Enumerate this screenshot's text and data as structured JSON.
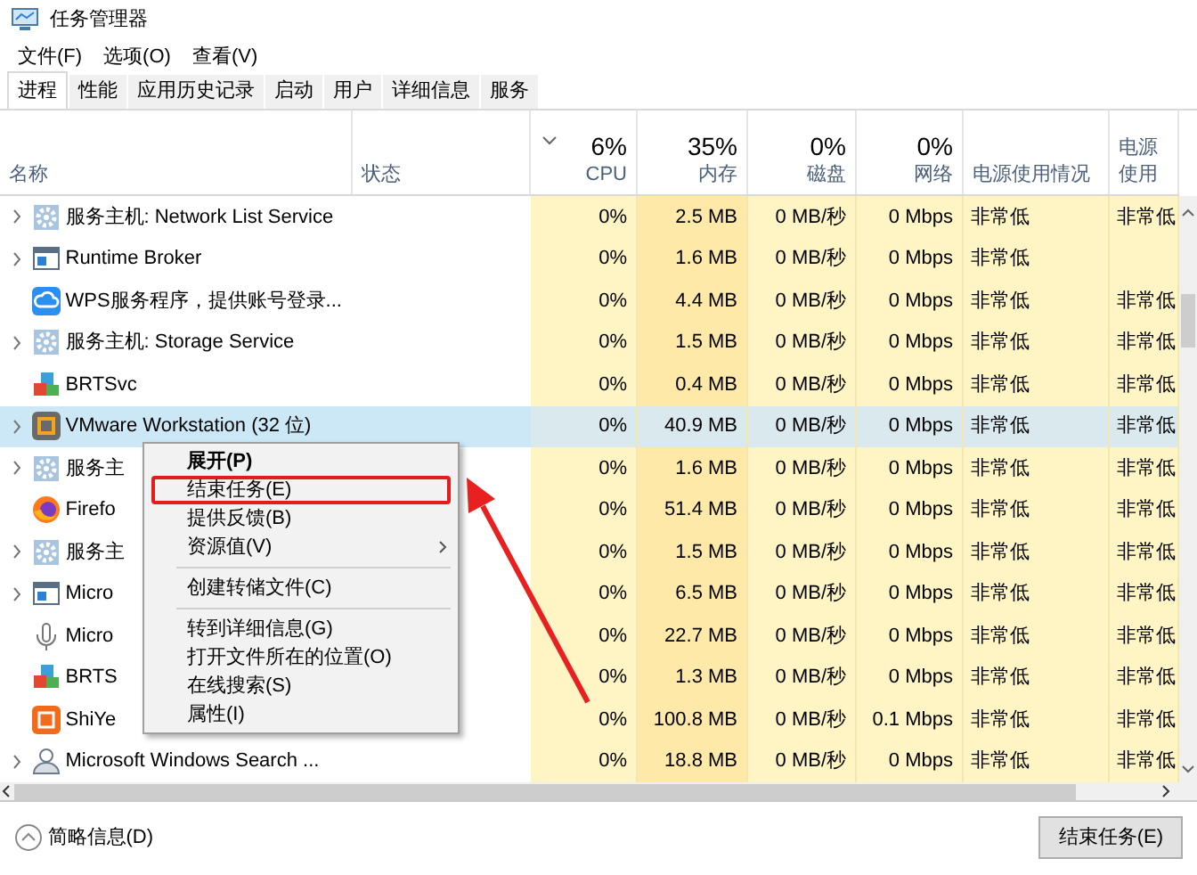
{
  "window": {
    "title": "任务管理器"
  },
  "menu": [
    "文件(F)",
    "选项(O)",
    "查看(V)"
  ],
  "tabs": [
    {
      "label": "进程",
      "selected": true
    },
    {
      "label": "性能",
      "selected": false
    },
    {
      "label": "应用历史记录",
      "selected": false
    },
    {
      "label": "启动",
      "selected": false
    },
    {
      "label": "用户",
      "selected": false
    },
    {
      "label": "详细信息",
      "selected": false
    },
    {
      "label": "服务",
      "selected": false
    }
  ],
  "columns": [
    {
      "label": "名称"
    },
    {
      "label": "状态"
    },
    {
      "usage": "6%",
      "label": "CPU",
      "sorted": true
    },
    {
      "usage": "35%",
      "label": "内存",
      "sorted": false
    },
    {
      "usage": "0%",
      "label": "磁盘",
      "sorted": false
    },
    {
      "usage": "0%",
      "label": "网络",
      "sorted": false
    },
    {
      "label": "电源使用情况"
    },
    {
      "label": "电源使用"
    }
  ],
  "rows": [
    {
      "name": "服务主机: Network List Service",
      "expandable": true,
      "kind": "gear",
      "cpu": "0%",
      "memory": "2.5 MB",
      "disk": "0 MB/秒",
      "network": "0 Mbps",
      "power": "非常低",
      "power_trend": "非常低",
      "selected": false
    },
    {
      "name": "Runtime Broker",
      "expandable": true,
      "kind": "window",
      "cpu": "0%",
      "memory": "1.6 MB",
      "disk": "0 MB/秒",
      "network": "0 Mbps",
      "power": "非常低",
      "selected": false
    },
    {
      "name": "WPS服务程序，提供账号登录...",
      "expandable": false,
      "kind": "cloud",
      "cpu": "0%",
      "memory": "4.4 MB",
      "disk": "0 MB/秒",
      "network": "0 Mbps",
      "power": "非常低",
      "power_trend": "非常低",
      "selected": false
    },
    {
      "name": "服务主机: Storage Service",
      "expandable": true,
      "kind": "gear",
      "cpu": "0%",
      "memory": "1.5 MB",
      "disk": "0 MB/秒",
      "network": "0 Mbps",
      "power": "非常低",
      "power_trend": "非常低",
      "selected": false
    },
    {
      "name": "BRTSvc",
      "expandable": false,
      "kind": "blocks",
      "cpu": "0%",
      "memory": "0.4 MB",
      "disk": "0 MB/秒",
      "network": "0 Mbps",
      "power": "非常低",
      "power_trend": "非常低",
      "selected": false
    },
    {
      "name": "VMware Workstation (32 位)",
      "expandable": true,
      "kind": "vm",
      "cpu": "0%",
      "memory": "40.9 MB",
      "disk": "0 MB/秒",
      "network": "0 Mbps",
      "power": "非常低",
      "power_trend": "非常低",
      "selected": true
    },
    {
      "name": "服务主",
      "expandable": true,
      "kind": "gear",
      "cpu": "0%",
      "memory": "1.6 MB",
      "disk": "0 MB/秒",
      "network": "0 Mbps",
      "power": "非常低",
      "power_trend": "非常低",
      "selected": false
    },
    {
      "name": "Firefo",
      "expandable": false,
      "kind": "fox",
      "cpu": "0%",
      "memory": "51.4 MB",
      "disk": "0 MB/秒",
      "network": "0 Mbps",
      "power": "非常低",
      "power_trend": "非常低",
      "selected": false
    },
    {
      "name": "服务主",
      "expandable": true,
      "kind": "gear",
      "cpu": "0%",
      "memory": "1.5 MB",
      "disk": "0 MB/秒",
      "network": "0 Mbps",
      "power": "非常低",
      "power_trend": "非常低",
      "selected": false
    },
    {
      "name": "Micro",
      "expandable": true,
      "kind": "window",
      "cpu": "0%",
      "memory": "6.5 MB",
      "disk": "0 MB/秒",
      "network": "0 Mbps",
      "power": "非常低",
      "power_trend": "非常低",
      "selected": false
    },
    {
      "name": "Micro",
      "expandable": false,
      "kind": "mic",
      "cpu": "0%",
      "memory": "22.7 MB",
      "disk": "0 MB/秒",
      "network": "0 Mbps",
      "power": "非常低",
      "power_trend": "非常低",
      "selected": false
    },
    {
      "name": "BRTS",
      "expandable": false,
      "kind": "blocks",
      "cpu": "0%",
      "memory": "1.3 MB",
      "disk": "0 MB/秒",
      "network": "0 Mbps",
      "power": "非常低",
      "power_trend": "非常低",
      "selected": false
    },
    {
      "name": "ShiYe",
      "expandable": false,
      "kind": "app",
      "cpu": "0%",
      "memory": "100.8 MB",
      "disk": "0 MB/秒",
      "network": "0.1 Mbps",
      "power": "非常低",
      "power_trend": "非常低",
      "selected": false
    },
    {
      "name": "Microsoft Windows Search ...",
      "expandable": true,
      "kind": "person",
      "cpu": "0%",
      "memory": "18.8 MB",
      "disk": "0 MB/秒",
      "network": "0 Mbps",
      "power": "非常低",
      "power_trend": "非常低",
      "selected": false
    }
  ],
  "context_menu": [
    {
      "kind": "item",
      "label": "展开(P)",
      "bold": true,
      "highlighted": false
    },
    {
      "kind": "item",
      "label": "结束任务(E)",
      "bold": false,
      "highlighted": true
    },
    {
      "kind": "item",
      "label": "提供反馈(B)",
      "bold": false,
      "highlighted": false
    },
    {
      "kind": "submenu",
      "label": "资源值(V)",
      "bold": false,
      "highlighted": false
    },
    {
      "kind": "separator"
    },
    {
      "kind": "item",
      "label": "创建转储文件(C)",
      "bold": false,
      "highlighted": false
    },
    {
      "kind": "separator"
    },
    {
      "kind": "item",
      "label": "转到详细信息(G)",
      "bold": false,
      "highlighted": false
    },
    {
      "kind": "item",
      "label": "打开文件所在的位置(O)",
      "bold": false,
      "highlighted": false
    },
    {
      "kind": "item",
      "label": "在线搜索(S)",
      "bold": false,
      "highlighted": false
    },
    {
      "kind": "item",
      "label": "属性(I)",
      "bold": false,
      "highlighted": false
    }
  ],
  "footer": {
    "toggle": "简略信息(D)",
    "button": "结束任务(E)"
  }
}
